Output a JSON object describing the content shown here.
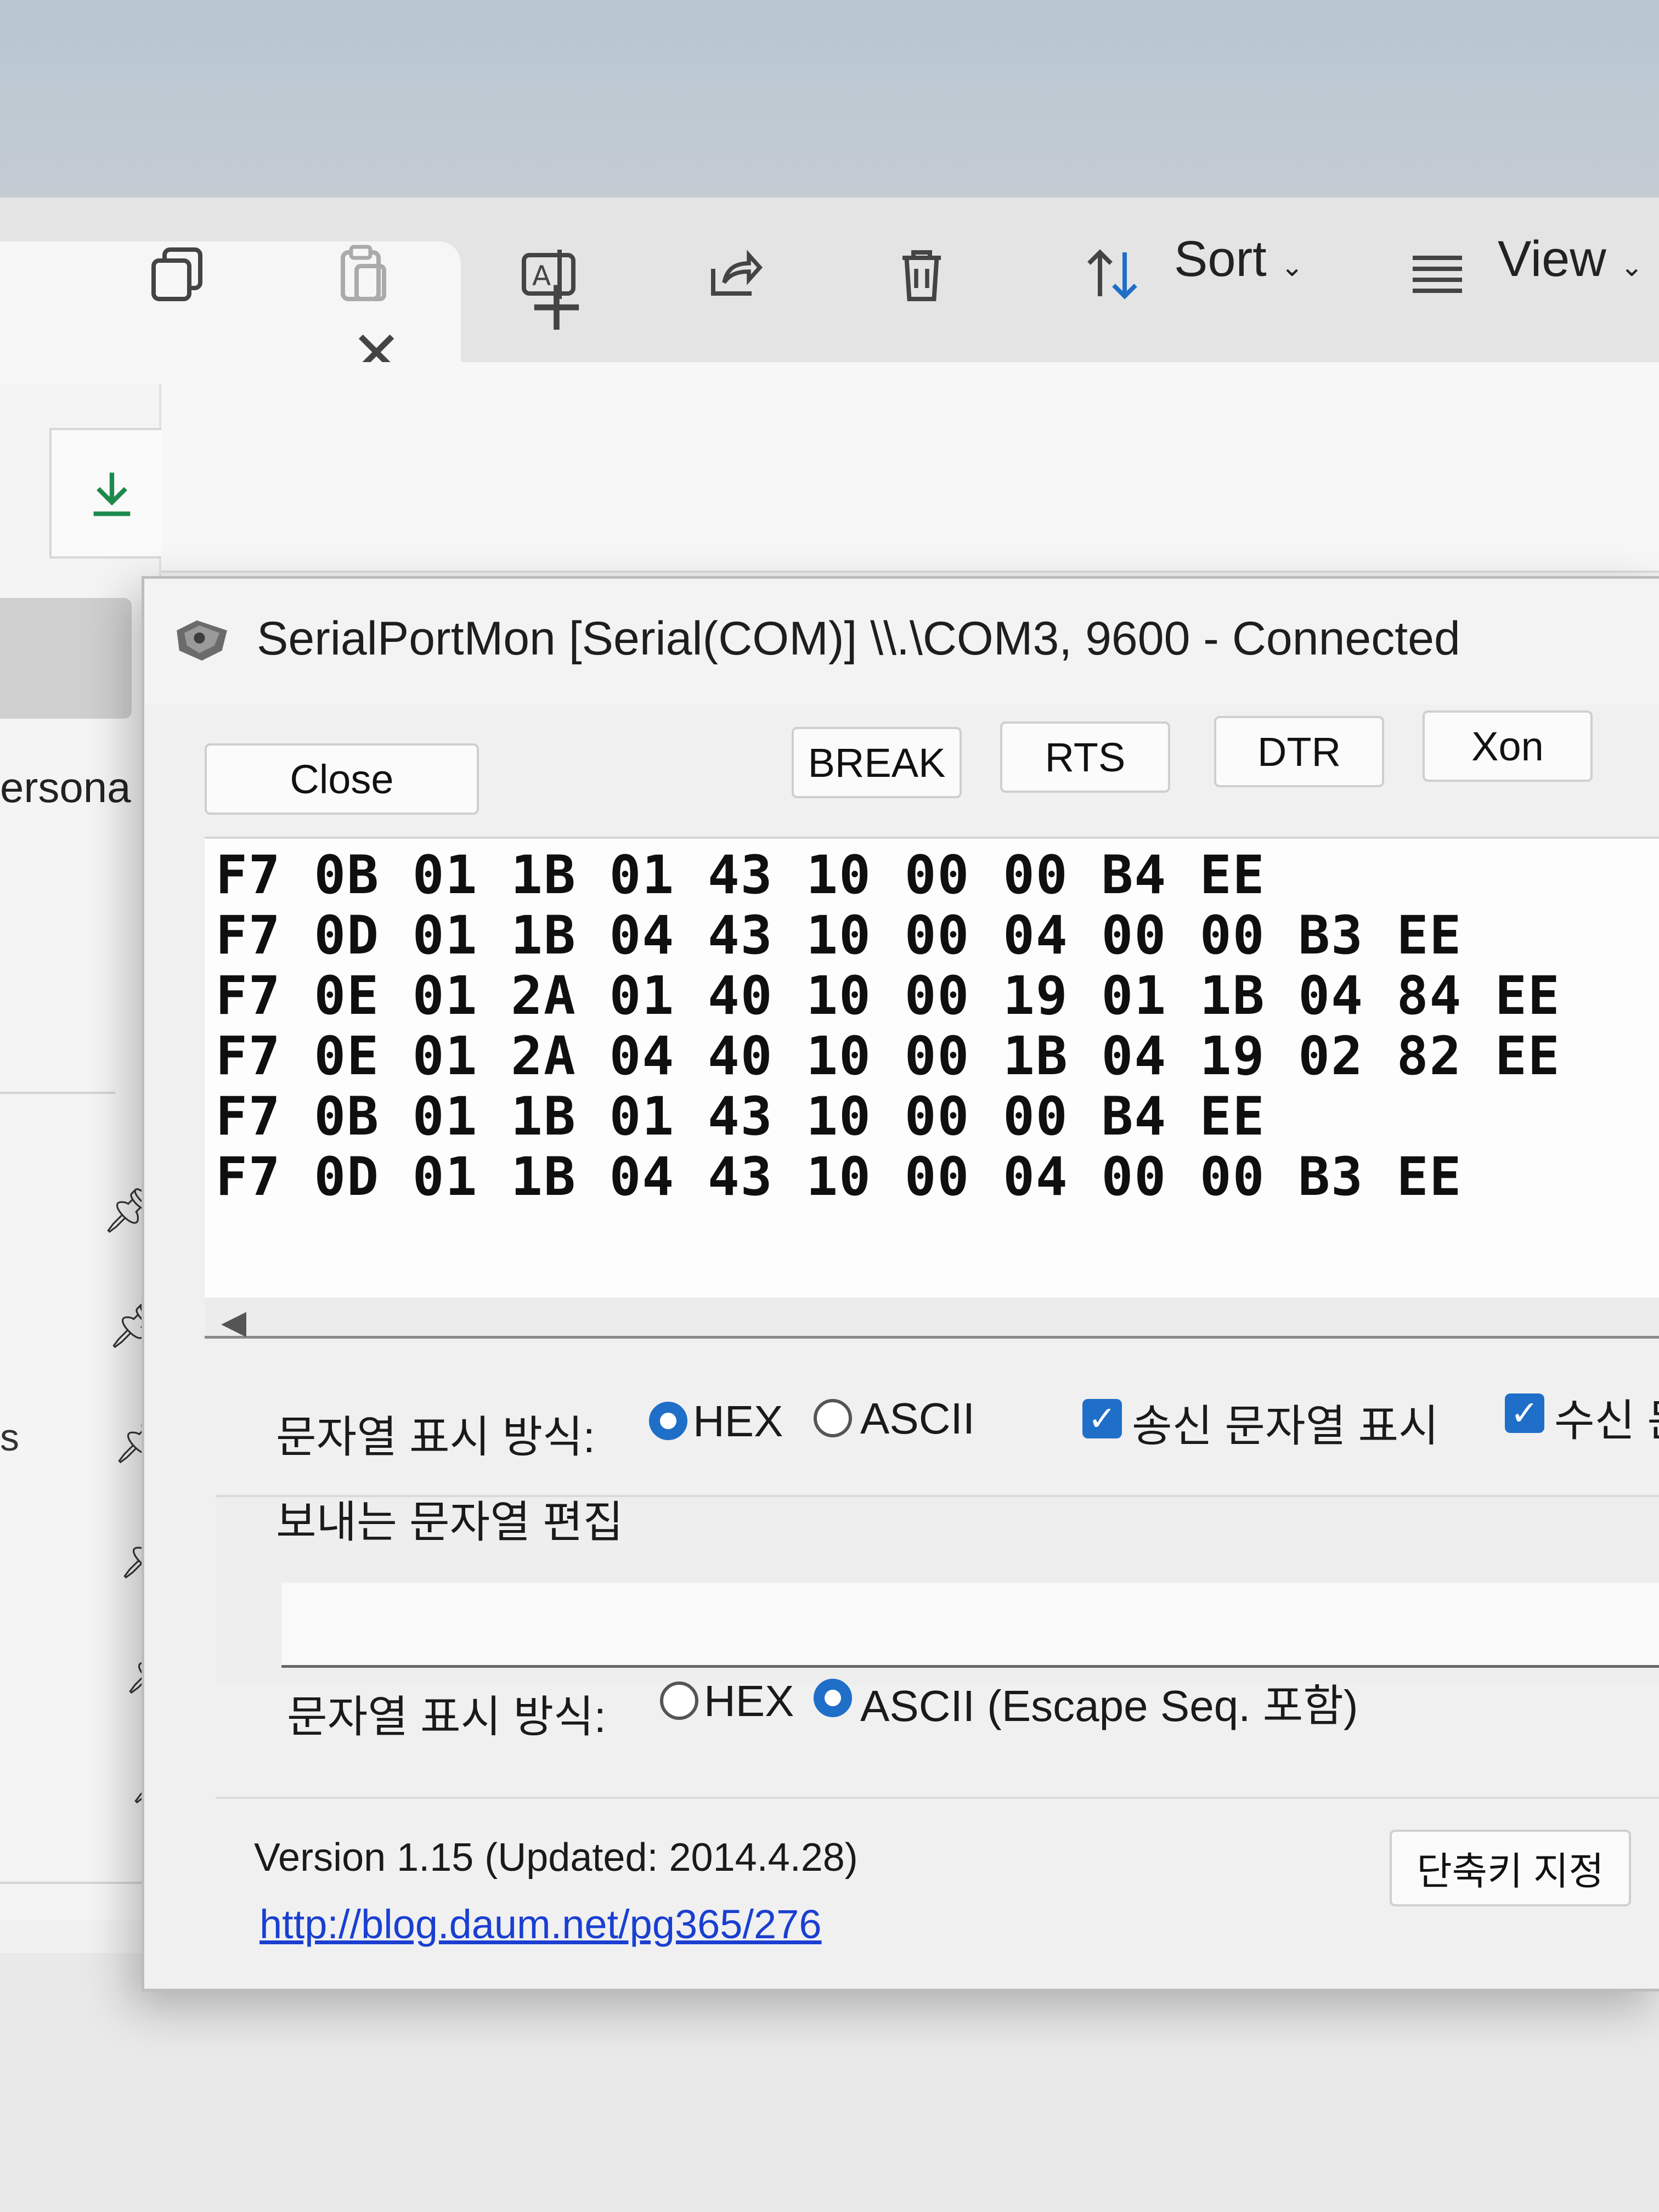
{
  "explorer": {
    "tab_close_glyph": "✕",
    "new_tab_glyph": "+",
    "toolbar": {
      "icons": [
        "copy-icon",
        "paste-icon",
        "rename-icon",
        "share-icon",
        "delete-icon"
      ],
      "sort_label": "Sort",
      "view_label": "View"
    },
    "nav": {
      "persona_text": "ersona",
      "s_text": "s"
    }
  },
  "dialog": {
    "title": "SerialPortMon [Serial(COM)] \\\\.\\COM3, 9600 - Connected",
    "buttons": {
      "close": "Close",
      "break": "BREAK",
      "rts": "RTS",
      "dtr": "DTR",
      "xon": "Xon"
    },
    "output_lines": [
      "F7 0B 01 1B 01 43 10 00 00 B4 EE",
      "F7 0D 01 1B 04 43 10 00 04 00 00 B3 EE",
      "F7 0E 01 2A 01 40 10 00 19 01 1B 04 84 EE",
      "F7 0E 01 2A 04 40 10 00 1B 04 19 02 82 EE",
      "F7 0B 01 1B 01 43 10 00 00 B4 EE",
      "F7 0D 01 1B 04 43 10 00 04 00 00 B3 EE"
    ],
    "receive_options": {
      "display_label": "문자열 표시 방식:",
      "hex_label": "HEX",
      "ascii_label": "ASCII",
      "selected": "HEX",
      "show_sent_label": "송신 문자열 표시",
      "show_sent_checked": true,
      "show_received_label": "수신 문",
      "show_received_checked": true
    },
    "send": {
      "edit_label": "보내는 문자열 편집",
      "value": "",
      "display_label": "문자열 표시 방식:",
      "hex_label": "HEX",
      "ascii_label": "ASCII (Escape Seq. 포함)",
      "selected": "ASCII"
    },
    "footer": {
      "version": "Version 1.15 (Updated: 2014.4.28)",
      "link": "http://blog.daum.net/pg365/276",
      "shortcut_button": "단축키 지정"
    }
  },
  "colors": {
    "accent": "#1f6fc8",
    "link": "#1a3fd0"
  }
}
